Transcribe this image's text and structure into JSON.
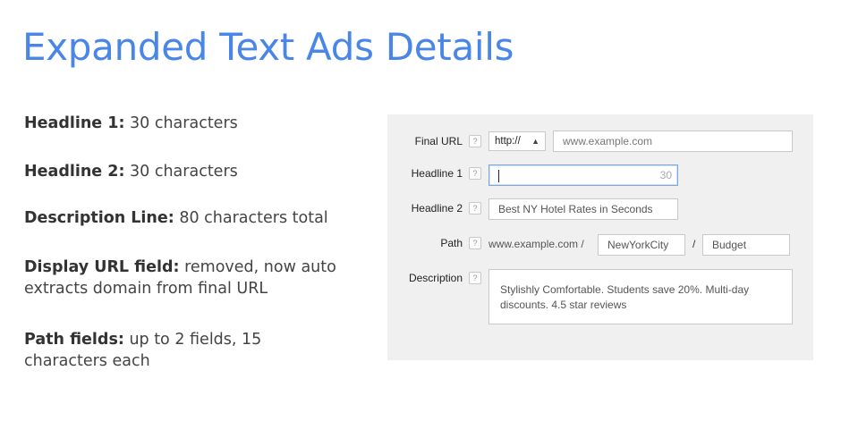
{
  "title": "Expanded Text Ads Details",
  "bullets": [
    {
      "label": "Headline 1:",
      "text": " 30 characters"
    },
    {
      "label": "Headline 2:",
      "text": " 30 characters"
    },
    {
      "label": "Description Line:",
      "text": " 80 characters total"
    },
    {
      "label": "Display URL field:",
      "text": " removed, now auto extracts domain from final URL"
    },
    {
      "label": "Path fields:",
      "text": " up to 2 fields, 15 characters each"
    }
  ],
  "form": {
    "help_glyph": "?",
    "final_url": {
      "label": "Final URL",
      "protocol_value": "http://",
      "protocol_icon": "select-arrows-icon",
      "placeholder": "www.example.com"
    },
    "headline1": {
      "label": "Headline 1",
      "value": "",
      "counter": "30"
    },
    "headline2": {
      "label": "Headline 2",
      "value": "Best NY Hotel Rates in Seconds"
    },
    "path": {
      "label": "Path",
      "domain": "www.example.com /",
      "path1": "NewYorkCity",
      "separator": "/",
      "path2": "Budget"
    },
    "description": {
      "label": "Description",
      "value": "Stylishly Comfortable. Students save 20%. Multi-day discounts. 4.5 star reviews"
    }
  }
}
